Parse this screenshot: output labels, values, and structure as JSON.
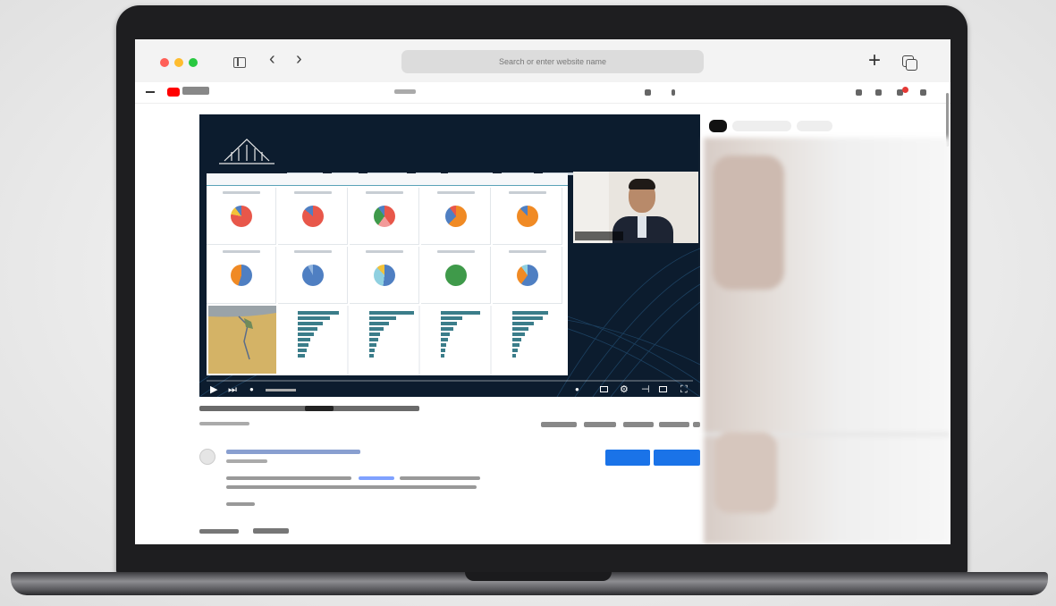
{
  "browser": {
    "address_placeholder": "Search or enter website name"
  },
  "youtube": {
    "search_placeholder": ""
  },
  "video": {
    "presenter_label": "",
    "progress_percent": 0
  },
  "colors": {
    "youtube_red": "#ff0000",
    "subscribe_blue": "#1a73e8",
    "traffic_red": "#ff5f57",
    "traffic_yellow": "#febc2e",
    "traffic_green": "#28c840"
  },
  "icons": [
    "sidebar-icon",
    "back-icon",
    "forward-icon",
    "new-tab-icon",
    "tabs-overview-icon",
    "menu-icon",
    "youtube-logo-icon",
    "search-icon",
    "mic-icon",
    "notifications-icon",
    "play-icon",
    "next-icon",
    "volume-icon",
    "settings-icon",
    "fullscreen-icon"
  ]
}
